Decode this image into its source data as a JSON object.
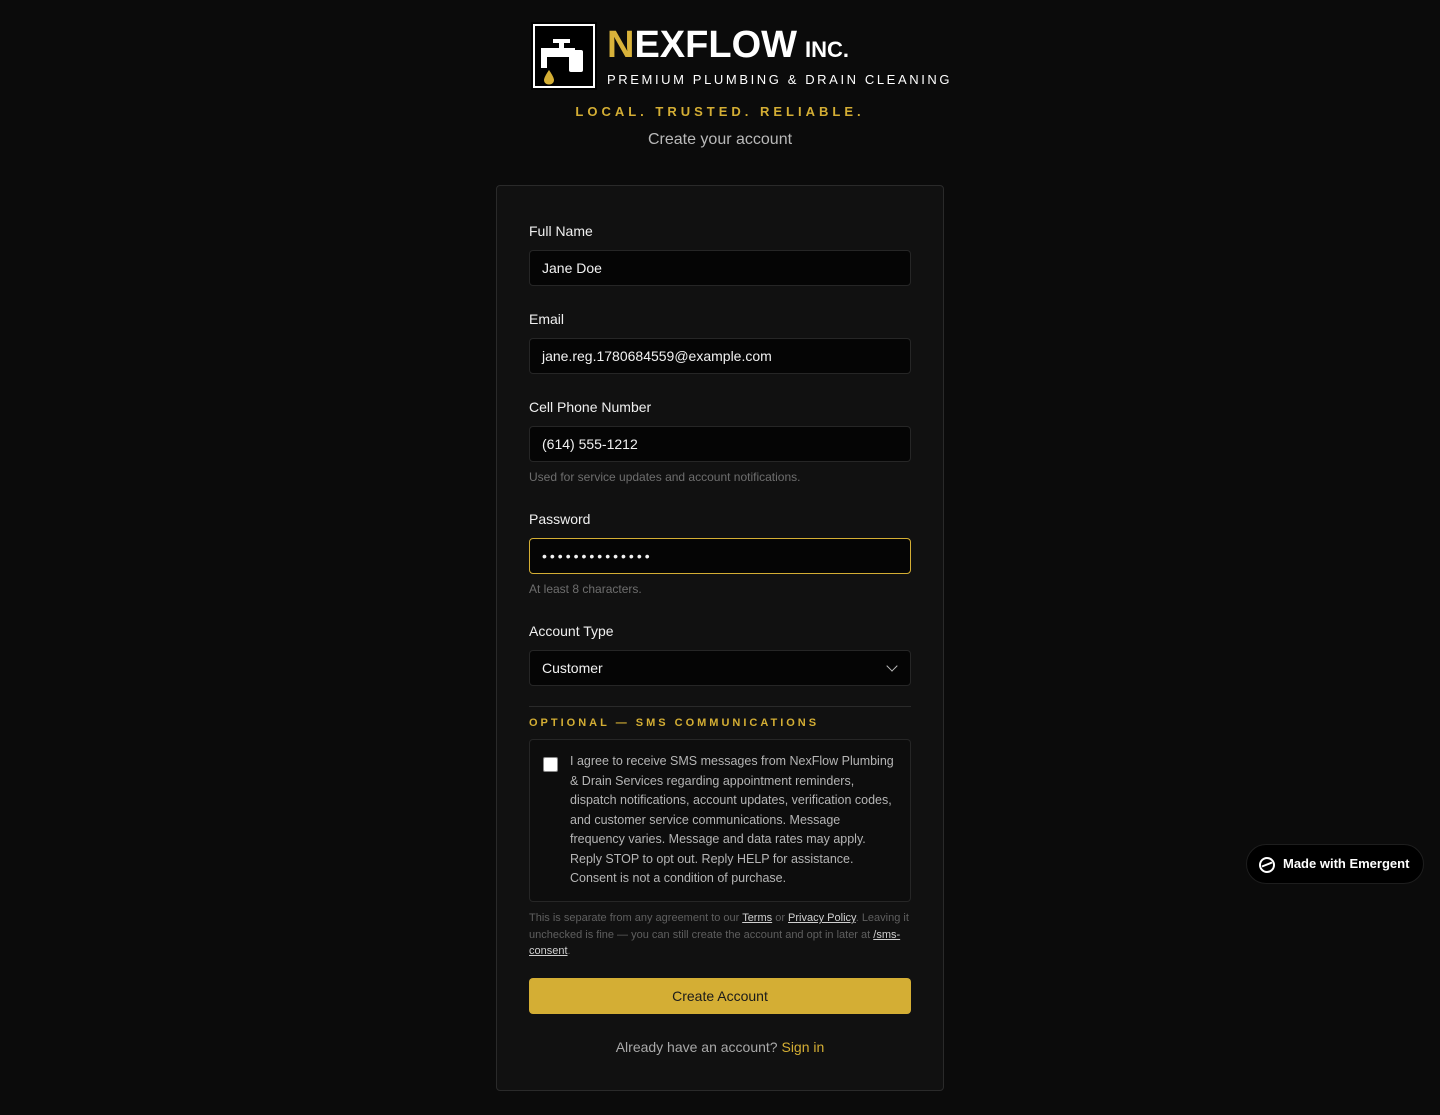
{
  "brand": {
    "name_first": "N",
    "name_rest": "EXFLOW",
    "name_suffix": "INC.",
    "tagline": "PREMIUM PLUMBING & DRAIN CLEANING",
    "slogan": "LOCAL. TRUSTED. RELIABLE.",
    "accent_color": "#d4ae34",
    "logo_icon": "faucet-drop-icon"
  },
  "page": {
    "subtitle": "Create your account"
  },
  "form": {
    "full_name": {
      "label": "Full Name",
      "value": "Jane Doe"
    },
    "email": {
      "label": "Email",
      "value": "jane.reg.1780684559@example.com"
    },
    "phone": {
      "label": "Cell Phone Number",
      "value": "(614) 555-1212",
      "hint": "Used for service updates and account notifications."
    },
    "password": {
      "label": "Password",
      "value": "••••••••••••••",
      "hint": "At least 8 characters."
    },
    "account_type": {
      "label": "Account Type",
      "selected": "Customer"
    },
    "sms": {
      "section_title": "OPTIONAL — SMS COMMUNICATIONS",
      "consent_text": "I agree to receive SMS messages from NexFlow Plumbing & Drain Services regarding appointment reminders, dispatch notifications, account updates, verification codes, and customer service communications. Message frequency varies. Message and data rates may apply. Reply STOP to opt out. Reply HELP for assistance. Consent is not a condition of purchase.",
      "checked": false,
      "legal_prefix": "This is separate from any agreement to our ",
      "terms_link": "Terms",
      "legal_or": " or ",
      "privacy_link": "Privacy Policy",
      "legal_middle": ". Leaving it unchecked is fine — you can still create the account and opt in later at ",
      "consent_link": "/sms-consent",
      "legal_suffix": "."
    },
    "submit_label": "Create Account",
    "signin_prompt": "Already have an account? ",
    "signin_link": "Sign in"
  },
  "badge": {
    "label": "Made with Emergent",
    "icon": "emergent-logo-icon"
  }
}
